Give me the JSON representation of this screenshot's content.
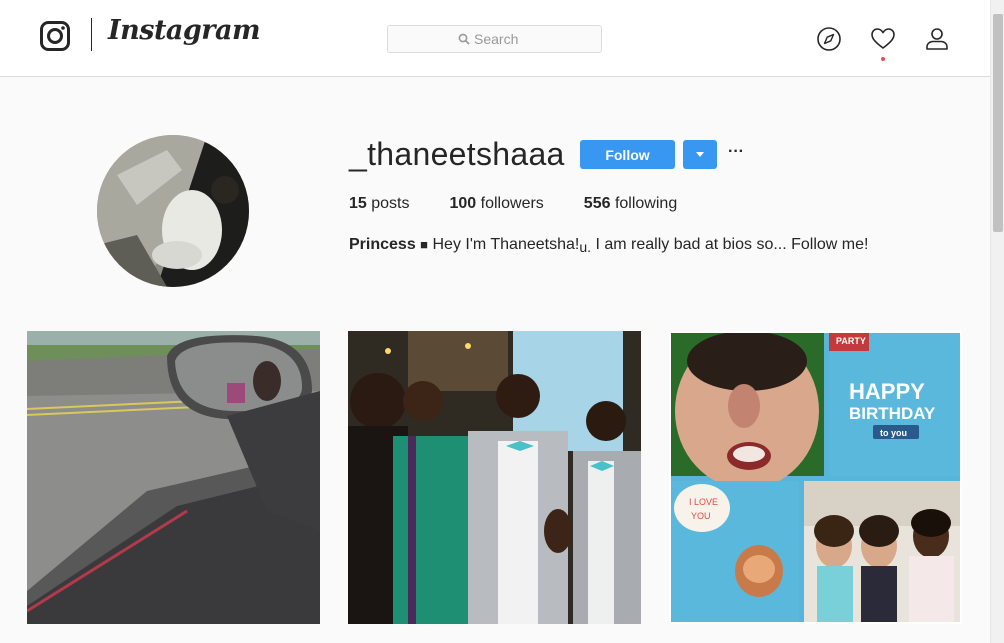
{
  "nav": {
    "wordmark": "Instagram",
    "search_placeholder": "Search",
    "icons": [
      "instagram-glyph-icon",
      "search-icon",
      "compass-icon",
      "heart-icon",
      "user-icon"
    ],
    "notification_color": "#ed4956"
  },
  "profile": {
    "username": "_thaneetshaaa",
    "follow_label": "Follow",
    "more_label": "···",
    "stats": {
      "posts_count": "15",
      "posts_label": "posts",
      "followers_count": "100",
      "followers_label": "followers",
      "following_count": "556",
      "following_label": "following"
    },
    "bio": {
      "name": "Princess",
      "glyph": "■",
      "text_1": "Hey I'm Thaneetsha!",
      "glyph_2": "u.",
      "text_2": "I am really bad at bios so... Follow me!"
    }
  },
  "posts": {
    "post_3": {
      "line1": "HAPPY",
      "line2": "BIRTHDAY",
      "line3": "to you",
      "bubble1": "I LOVE",
      "bubble2": "YOU",
      "party_tag": "PARTY"
    }
  },
  "colors": {
    "accent": "#3897f0",
    "text": "#262626",
    "border": "#dbdbdb",
    "background": "#fafafa"
  }
}
